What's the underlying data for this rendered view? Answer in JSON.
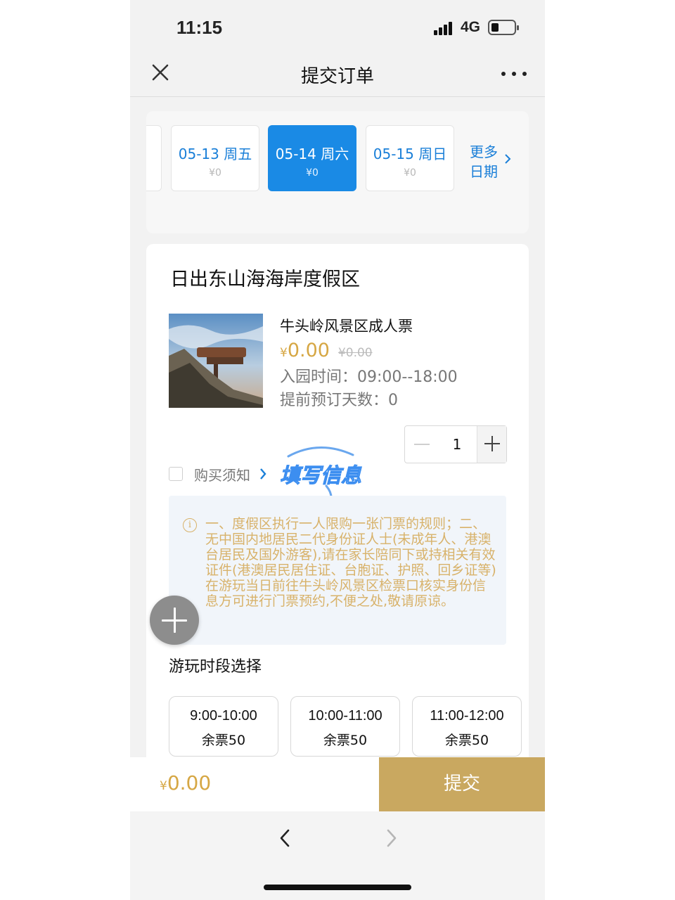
{
  "status_bar": {
    "time": "11:15",
    "network": "4G"
  },
  "header": {
    "title": "提交订单"
  },
  "dates": {
    "items": [
      {
        "label": "05-13 周五",
        "price": "¥0",
        "selected": false
      },
      {
        "label": "05-14 周六",
        "price": "¥0",
        "selected": true
      },
      {
        "label": "05-15 周日",
        "price": "¥0",
        "selected": false
      }
    ],
    "more_line1": "更多",
    "more_line2": "日期"
  },
  "product": {
    "resort_name": "日出东山海海岸度假区",
    "ticket_name": "牛头岭风景区成人票",
    "currency": "¥",
    "price": "0.00",
    "original_price": "¥0.00",
    "entry_time": "入园时间：09:00--18:00",
    "advance_days": "提前预订天数：0",
    "quantity": "1"
  },
  "notice": {
    "label": "购买须知",
    "text": "一、度假区执行一人限购一张门票的规则；二、无中国内地居民二代身份证人士(未成年人、港澳台居民及国外游客),请在家长陪同下或持相关有效证件(港澳居民居住证、台胞证、护照、回乡证等)在游玩当日前往牛头岭风景区检票口核实身份信息方可进行门票预约,不便之处,敬请原谅。"
  },
  "stamp_text": "填写信息",
  "slots": {
    "title": "游玩时段选择",
    "items": [
      {
        "time": "9:00-10:00",
        "remain": "余票50"
      },
      {
        "time": "10:00-11:00",
        "remain": "余票50"
      },
      {
        "time": "11:00-12:00",
        "remain": "余票50"
      }
    ]
  },
  "footer": {
    "currency": "¥",
    "total": "0.00",
    "submit_label": "提交"
  },
  "colors": {
    "accent_blue": "#1a8ae5",
    "gold": "#d6a744",
    "submit_bg": "#c9a860"
  },
  "icons": [
    "close-icon",
    "more-icon",
    "chevron-right-icon",
    "plus-icon",
    "minus-icon",
    "info-icon",
    "back-arrow-icon",
    "forward-arrow-icon"
  ]
}
